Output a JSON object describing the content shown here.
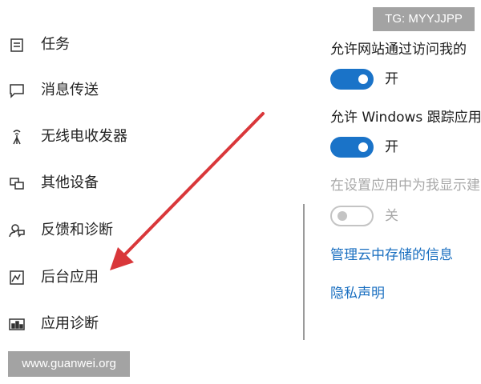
{
  "sidebar": {
    "items": [
      {
        "label": "任务",
        "icon": "task-icon"
      },
      {
        "label": "消息传送",
        "icon": "message-icon"
      },
      {
        "label": "无线电收发器",
        "icon": "radio-antenna-icon"
      },
      {
        "label": "其他设备",
        "icon": "devices-icon"
      },
      {
        "label": "反馈和诊断",
        "icon": "feedback-icon"
      },
      {
        "label": "后台应用",
        "icon": "background-apps-icon"
      },
      {
        "label": "应用诊断",
        "icon": "app-diagnostics-icon"
      }
    ]
  },
  "settings": {
    "website_access": {
      "title": "允许网站通过访问我的",
      "state": "开",
      "on": true
    },
    "windows_tracking": {
      "title": "允许 Windows 跟踪应用",
      "state": "开",
      "on": true
    },
    "show_suggestions": {
      "title": "在设置应用中为我显示建",
      "state": "关",
      "on": false
    },
    "manage_cloud_link": "管理云中存储的信息",
    "privacy_link": "隐私声明"
  },
  "watermarks": {
    "top_right": "TG: MYYJJPP",
    "bottom_left": "www.guanwei.org"
  },
  "colors": {
    "accent": "#1a73c8",
    "link": "#1a6fc0",
    "annotation_arrow": "#d9373a",
    "watermark_bg": "#a3a3a3"
  }
}
